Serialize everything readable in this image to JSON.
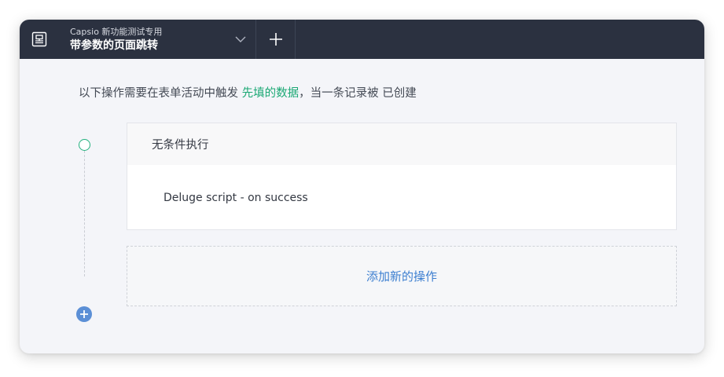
{
  "header": {
    "app_name": "Capsio 新功能测试专用",
    "page_name": "带参数的页面跳转"
  },
  "trigger": {
    "prefix": "以下操作需要在表单活动中触发 ",
    "form_name": "先填的数据",
    "suffix": "，当一条记录被 已创建"
  },
  "action_card": {
    "condition_label": "无条件执行",
    "script_label": "Deluge script - on success"
  },
  "add_action": {
    "label": "添加新的操作"
  },
  "colors": {
    "topbar": "#2b3140",
    "accent_green": "#1aa874",
    "accent_blue": "#3d7fd0"
  },
  "icons": {
    "app": "app-page-icon",
    "dropdown": "chevron-down-icon",
    "add_tab": "plus-icon",
    "add_action": "plus-circle-icon"
  }
}
